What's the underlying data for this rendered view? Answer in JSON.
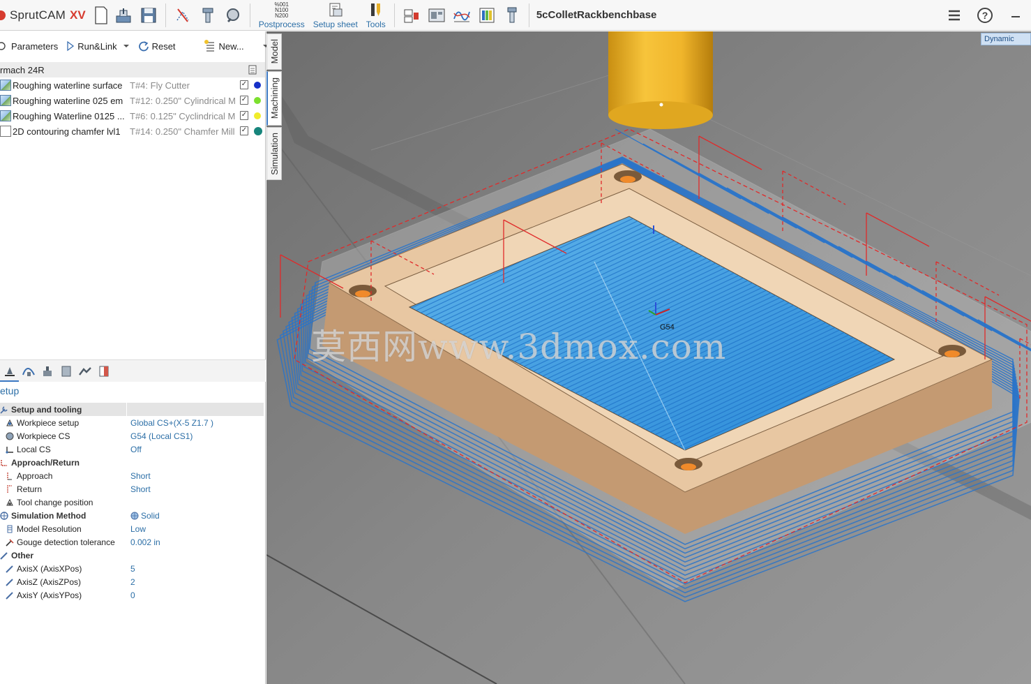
{
  "app": {
    "name": "SprutCAM",
    "version": "XV",
    "project_title": "5cColletRackbenchbase"
  },
  "toolbar": {
    "postprocess_label": "Postprocess",
    "postprocess_codes": [
      "%001",
      "N100",
      "N200"
    ],
    "setup_sheet_label": "Setup sheet",
    "tools_label": "Tools"
  },
  "ops_toolbar": {
    "parameters_label": "Parameters",
    "runlink_label": "Run&Link",
    "reset_label": "Reset",
    "new_label": "New..."
  },
  "machine": {
    "name": "rmach 24R"
  },
  "operations": [
    {
      "name": "Roughing waterline surface",
      "tool": "T#4: Fly Cutter",
      "checked": true,
      "color": "#1630c8"
    },
    {
      "name": "Roughing waterline 025 em",
      "tool": "T#12: 0.250\" Cylindrical M",
      "checked": true,
      "color": "#7ce02e"
    },
    {
      "name": "Roughing Waterline 0125 ...",
      "tool": "T#6: 0.125\" Cyclindrical M",
      "checked": true,
      "color": "#f0ec2a"
    },
    {
      "name": "2D contouring chamfer lvl1",
      "tool": "T#14: 0.250\" Chamfer Mill",
      "checked": true,
      "color": "#17857c"
    }
  ],
  "side_tabs": {
    "model": "Model",
    "machining": "Machining",
    "simulation": "Simulation"
  },
  "properties": {
    "title": "etup",
    "setup_and_tooling": "Setup and tooling",
    "workpiece_setup_label": "Workpiece setup",
    "workpiece_setup_value": "Global CS+(X-5 Z1.7 )",
    "workpiece_cs_label": "Workpiece CS",
    "workpiece_cs_value": "G54 (Local CS1)",
    "local_cs_label": "Local CS",
    "local_cs_value": "Off",
    "approach_return": "Approach/Return",
    "approach_label": "Approach",
    "approach_value": "Short",
    "return_label": "Return",
    "return_value": "Short",
    "tool_change_label": "Tool change position",
    "sim_method_label": "Simulation Method",
    "sim_method_value": "Solid",
    "model_res_label": "Model Resolution",
    "model_res_value": "Low",
    "gouge_label": "Gouge detection tolerance",
    "gouge_value": "0.002 in",
    "other": "Other",
    "axisx_label": "AxisX (AxisXPos)",
    "axisx_value": "5",
    "axisz_label": "AxisZ (AxisZPos)",
    "axisz_value": "2",
    "axisy_label": "AxisY (AxisYPos)",
    "axisy_value": "0"
  },
  "viewport": {
    "mode_badge": "Dynamic",
    "cs_label": "G54",
    "watermark": "莫西网www.3dmox.com"
  },
  "colors": {
    "toolpath_blue": "#2a74c9",
    "toolpath_red": "#e02a2a",
    "stock": "#e9c9a6",
    "tool": "#f2b72a",
    "link_blue": "#2b6ea6"
  }
}
